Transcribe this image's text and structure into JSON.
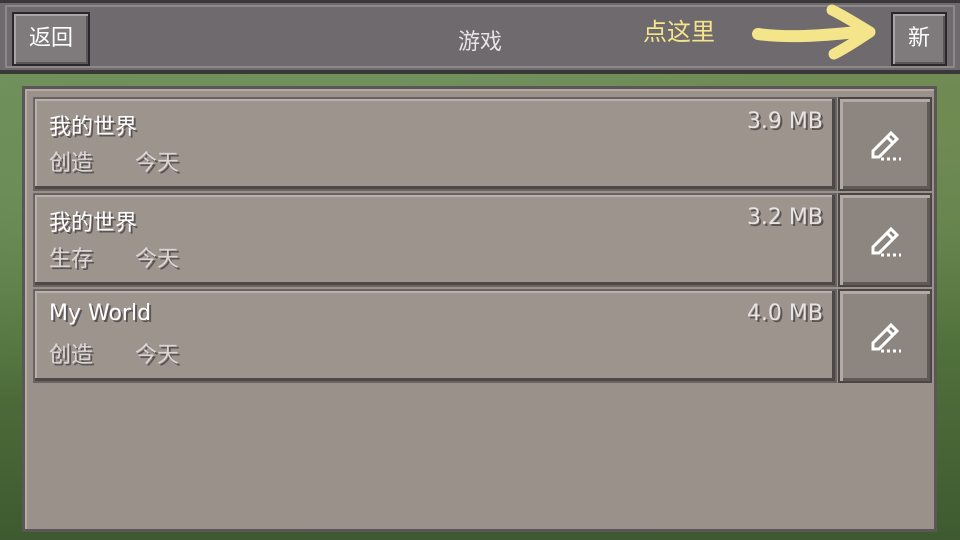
{
  "header": {
    "back_label": "返回",
    "title": "游戏",
    "hint": "点这里",
    "new_label": "新"
  },
  "worlds": [
    {
      "name": "我的世界",
      "size": "3.9 MB",
      "mode": "创造",
      "date": "今天"
    },
    {
      "name": "我的世界",
      "size": "3.2 MB",
      "mode": "生存",
      "date": "今天"
    },
    {
      "name": "My World",
      "size": "4.0 MB",
      "mode": "创造",
      "date": "今天"
    }
  ],
  "icons": {
    "edit": "pencil-icon",
    "hint_arrow": "arrow-right-icon"
  },
  "colors": {
    "hint": "#f4e48a",
    "panel": "#9b918b",
    "header": "#6f6a6d"
  }
}
